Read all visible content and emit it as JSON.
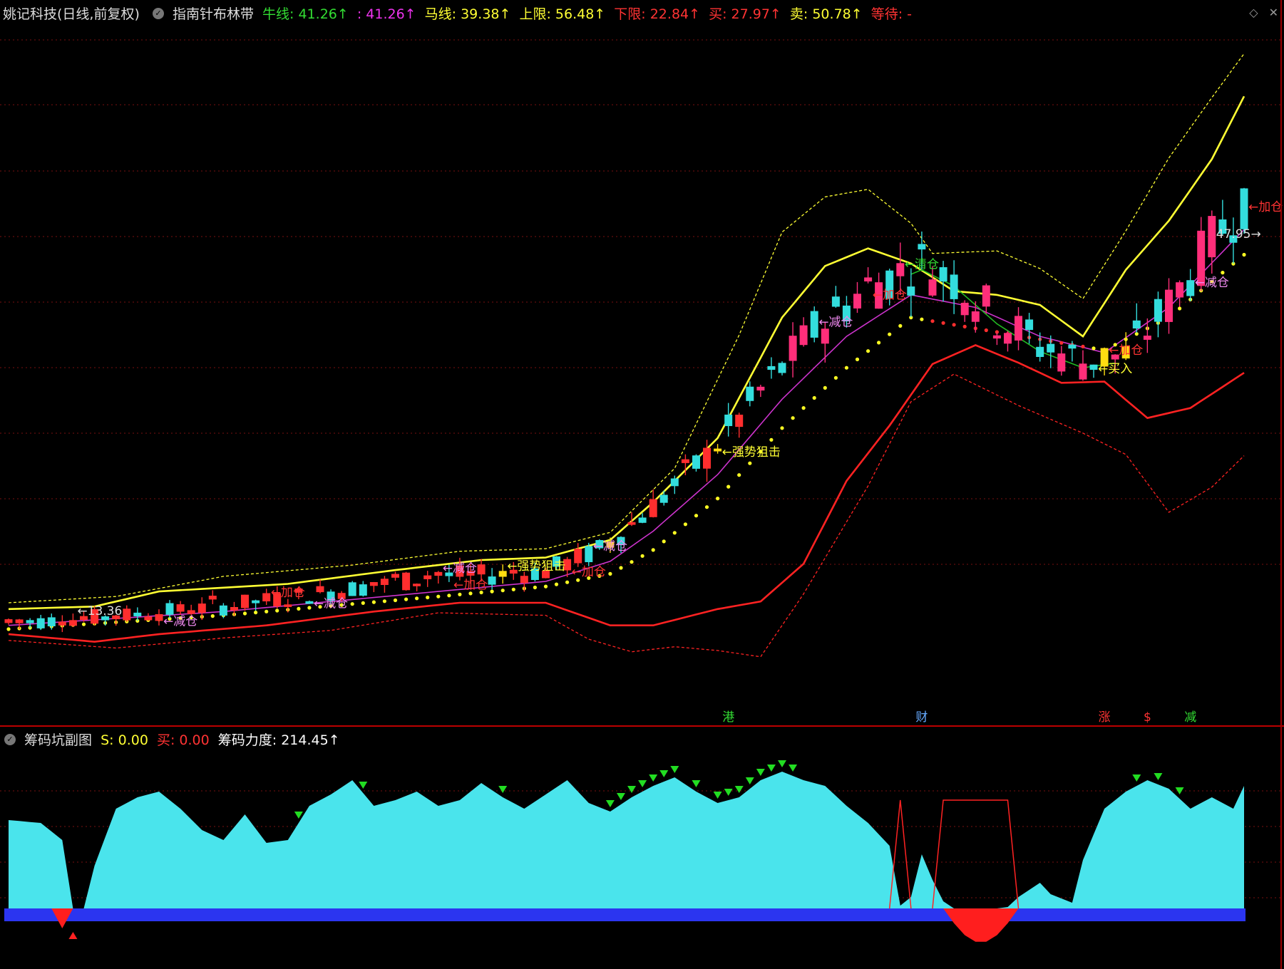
{
  "header": {
    "stock": "姚记科技(日线,前复权)",
    "indicator": "指南针布林带",
    "items": [
      {
        "label": "牛线: 41.26↑",
        "color": "#33dd33"
      },
      {
        "label": ": 41.26↑",
        "color": "#ee33ee"
      },
      {
        "label": "马线: 39.38↑",
        "color": "#ffff33"
      },
      {
        "label": "上限: 56.48↑",
        "color": "#ffff33"
      },
      {
        "label": "下限: 22.84↑",
        "color": "#ff3333"
      },
      {
        "label": "买: 27.97↑",
        "color": "#ff3333"
      },
      {
        "label": "卖: 50.78↑",
        "color": "#ffff33"
      },
      {
        "label": "等待: -",
        "color": "#ff3333"
      }
    ],
    "icons": [
      "diamond-icon",
      "close-icon"
    ]
  },
  "subheader": {
    "title": "筹码坑副图",
    "items": [
      {
        "label": "S: 0.00",
        "color": "#ffff33"
      },
      {
        "label": "买: 0.00",
        "color": "#ff3333"
      },
      {
        "label": "筹码力度: 214.45↑",
        "color": "#ffffff"
      }
    ]
  },
  "chart_data": [
    {
      "type": "candlestick",
      "title": "指南针布林带",
      "ylim": [
        5,
        60
      ],
      "n": 116,
      "annotations": [
        {
          "i": 6,
          "text": "←13.36",
          "color": "#dddddd"
        },
        {
          "i": 14,
          "text": "←减仓",
          "color": "#ee88ee"
        },
        {
          "i": 24,
          "text": "←加仓",
          "color": "#ff3333"
        },
        {
          "i": 28,
          "text": "←减仓",
          "color": "#ee88ee"
        },
        {
          "i": 40,
          "text": "←减仓",
          "color": "#ee88ee"
        },
        {
          "i": 41,
          "text": "←加仓",
          "color": "#ff3333"
        },
        {
          "i": 46,
          "text": "←强势狙击",
          "color": "#ffff33"
        },
        {
          "i": 52,
          "text": "←加仓",
          "color": "#ff3333"
        },
        {
          "i": 54,
          "text": "←减仓",
          "color": "#ee88ee"
        },
        {
          "i": 66,
          "text": "←强势狙击",
          "color": "#ffff33"
        },
        {
          "i": 75,
          "text": "←减仓",
          "color": "#ee88ee"
        },
        {
          "i": 80,
          "text": "←加仓",
          "color": "#ff3333"
        },
        {
          "i": 83,
          "text": "←清仓",
          "color": "#33dd33"
        },
        {
          "i": 101,
          "text": "←买入",
          "color": "#ffff33"
        },
        {
          "i": 102,
          "text": "←加仓",
          "color": "#ff3333"
        },
        {
          "i": 110,
          "text": "←减仓",
          "color": "#ee88ee"
        },
        {
          "i": 112,
          "text": "47.95→",
          "color": "#dddddd"
        },
        {
          "i": 115,
          "text": "←加仓",
          "color": "#ff3333"
        }
      ],
      "markers": [
        {
          "i": 67,
          "text": "港",
          "color": "#33dd33"
        },
        {
          "i": 85,
          "text": "财",
          "color": "#66aaff"
        },
        {
          "i": 102,
          "text": "涨",
          "color": "#ff3333"
        },
        {
          "i": 106,
          "text": "$",
          "color": "#ff3333"
        },
        {
          "i": 110,
          "text": "减",
          "color": "#33dd33"
        }
      ]
    },
    {
      "type": "area",
      "title": "筹码坑副图",
      "ylim": [
        0,
        100
      ]
    }
  ],
  "colors": {
    "up": "#ff2e2e",
    "down": "#33dddd",
    "upper": "#ffff33",
    "lower": "#ff2222",
    "purple": "#cc33cc",
    "green": "#22bb22",
    "dot": "#ffff22",
    "area": "#4ae4ec",
    "base": "#2b35f0",
    "pit": "#ff1e1e"
  }
}
